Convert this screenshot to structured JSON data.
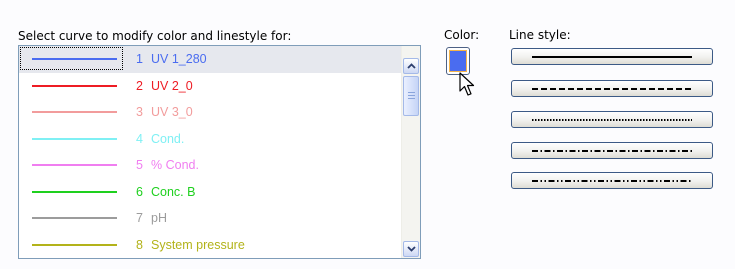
{
  "labels": {
    "prompt": "Select curve to modify color and linestyle for:",
    "color": "Color:",
    "line_style": "Line style:"
  },
  "curves": [
    {
      "number": "1",
      "name": "UV 1_280",
      "color": "#4a6cf0",
      "selected": true
    },
    {
      "number": "2",
      "name": "UV 2_0",
      "color": "#ee1c24",
      "selected": false
    },
    {
      "number": "3",
      "name": "UV 3_0",
      "color": "#f29c9c",
      "selected": false
    },
    {
      "number": "4",
      "name": "Cond.",
      "color": "#7ff0f4",
      "selected": false
    },
    {
      "number": "5",
      "name": "% Cond.",
      "color": "#f07ef0",
      "selected": false
    },
    {
      "number": "6",
      "name": "Conc. B",
      "color": "#1ed01e",
      "selected": false
    },
    {
      "number": "7",
      "name": "pH",
      "color": "#9c9c9c",
      "selected": false
    },
    {
      "number": "8",
      "name": "System pressure",
      "color": "#b3b31a",
      "selected": false
    }
  ],
  "current_color": "#4a6cf0",
  "line_styles": [
    {
      "name": "solid"
    },
    {
      "name": "dashed"
    },
    {
      "name": "dotted"
    },
    {
      "name": "dash-dot"
    },
    {
      "name": "dash-dot-dot"
    }
  ]
}
